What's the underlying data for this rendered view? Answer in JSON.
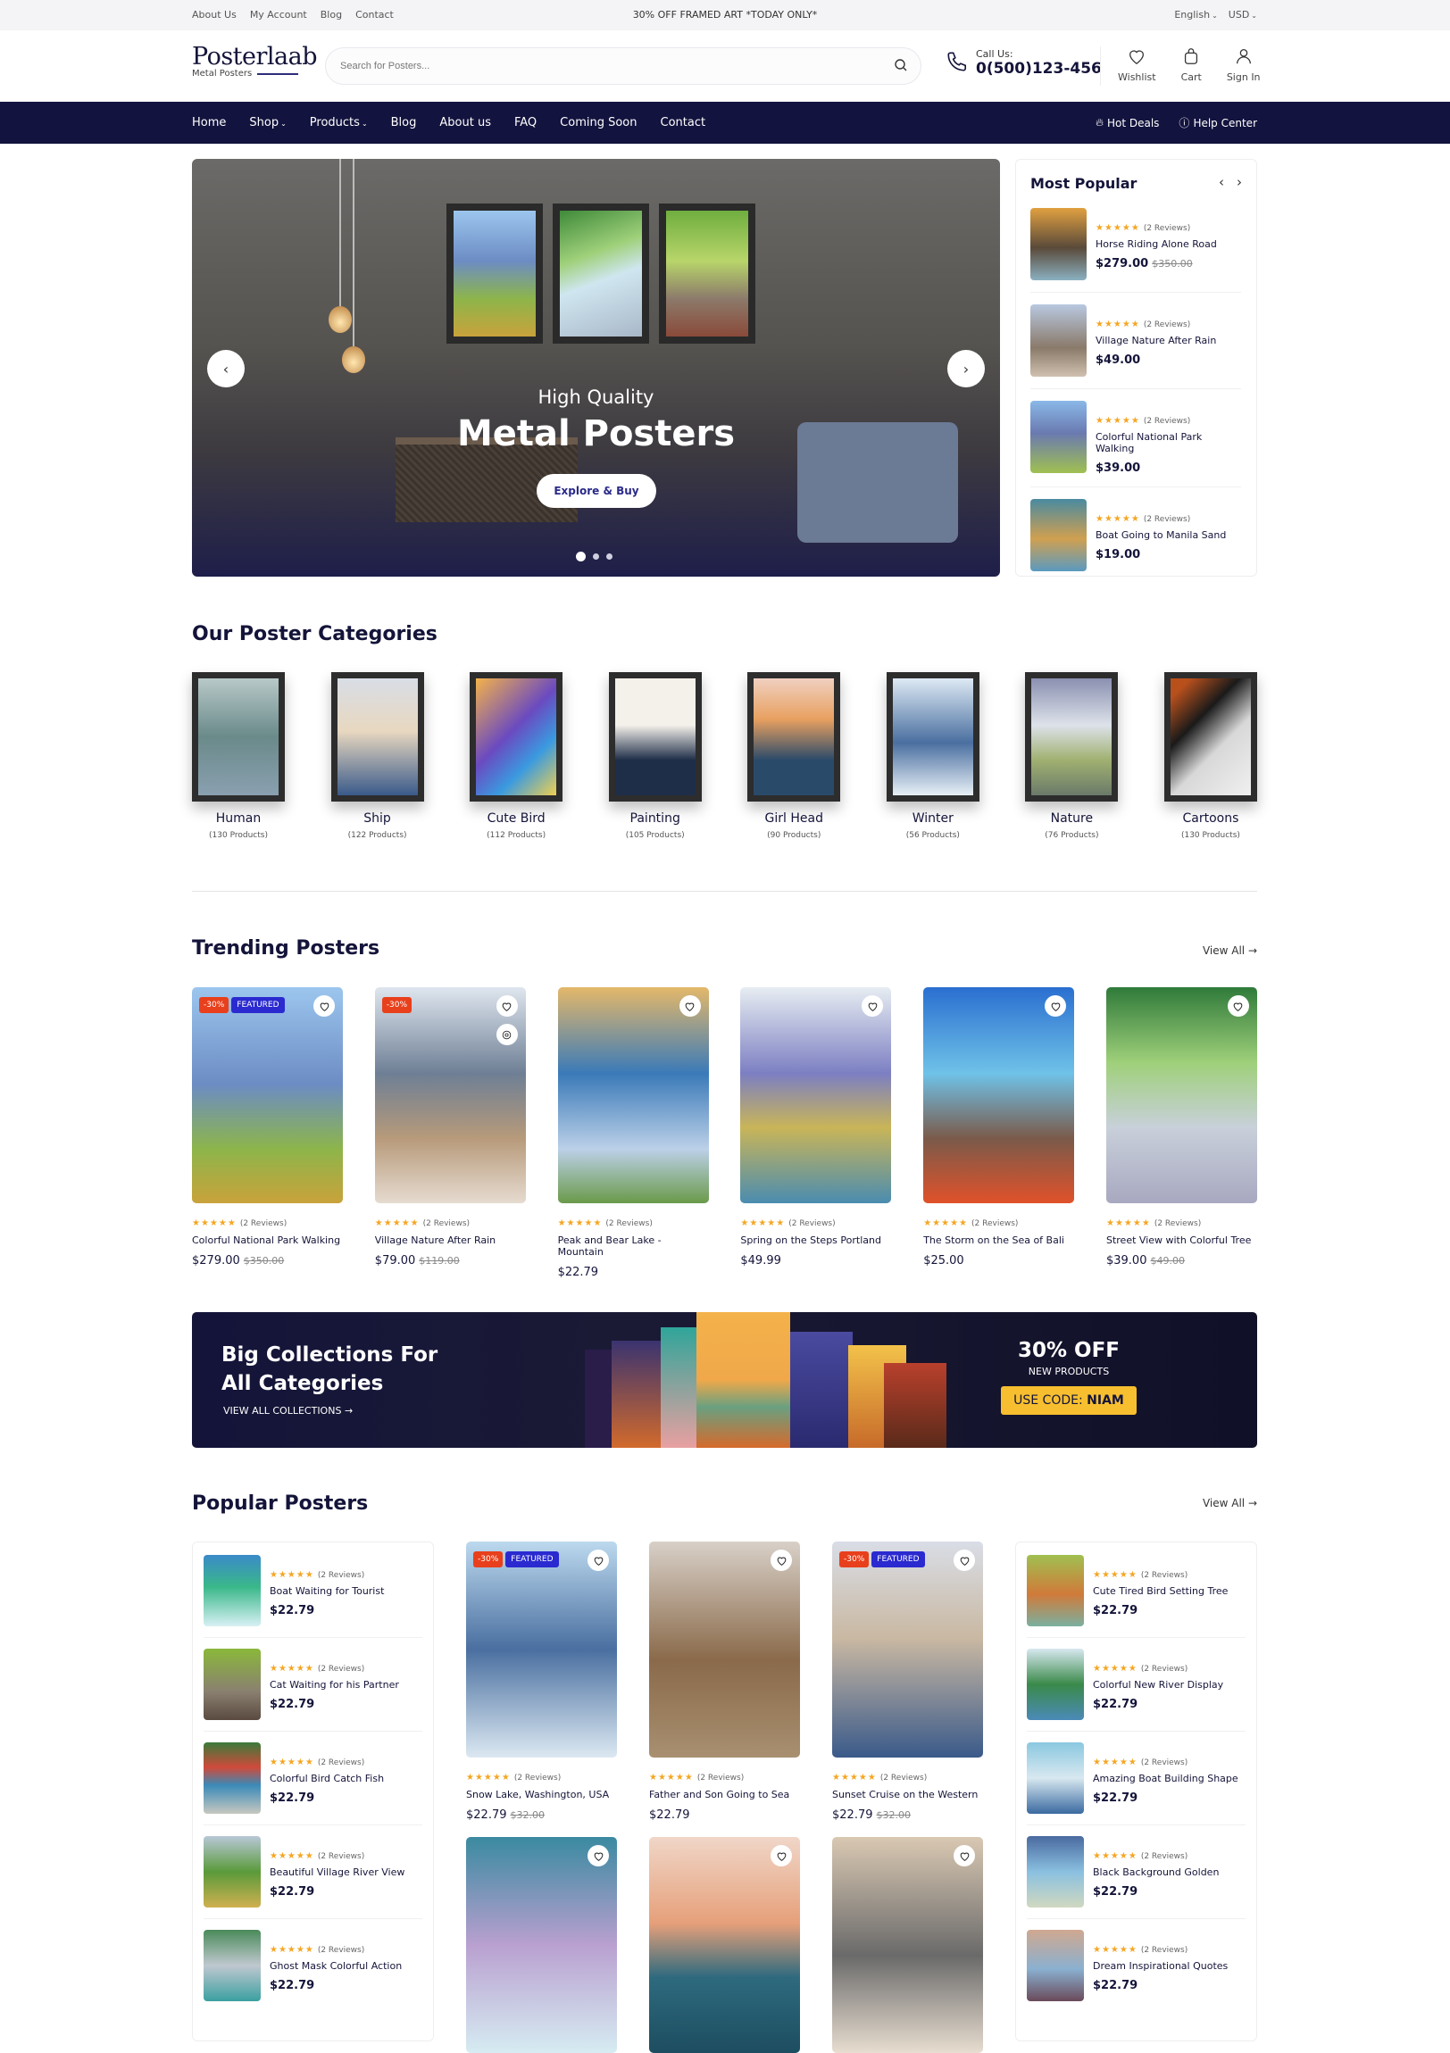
{
  "topbar": {
    "links": [
      "About Us",
      "My Account",
      "Blog",
      "Contact"
    ],
    "promo": "30% OFF FRAMED ART *TODAY ONLY*",
    "language": "English",
    "currency": "USD"
  },
  "header": {
    "logo_name": "Posterlaab",
    "logo_sub": "Metal Posters",
    "search_placeholder": "Search for Posters...",
    "call_label": "Call Us:",
    "phone": "0(500)123-456",
    "wishlist": "Wishlist",
    "cart": "Cart",
    "signin": "Sign In"
  },
  "nav": {
    "items": [
      {
        "label": "Home",
        "dropdown": false
      },
      {
        "label": "Shop",
        "dropdown": true
      },
      {
        "label": "Products",
        "dropdown": true
      },
      {
        "label": "Blog",
        "dropdown": false
      },
      {
        "label": "About us",
        "dropdown": false
      },
      {
        "label": "FAQ",
        "dropdown": false
      },
      {
        "label": "Coming Soon",
        "dropdown": false
      },
      {
        "label": "Contact",
        "dropdown": false
      }
    ],
    "hot_deals": "Hot Deals",
    "help_center": "Help Center"
  },
  "hero": {
    "subtitle": "High Quality",
    "title": "Metal Posters",
    "button": "Explore & Buy",
    "slide_count": 3,
    "active_slide": 1
  },
  "most_popular": {
    "title": "Most Popular",
    "items": [
      {
        "name": "Horse Riding Alone Road",
        "price": "$279.00",
        "old_price": "$350.00",
        "reviews": "(2 Reviews)",
        "rating": 5
      },
      {
        "name": "Village Nature After Rain",
        "price": "$49.00",
        "old_price": "",
        "reviews": "(2 Reviews)",
        "rating": 5
      },
      {
        "name": "Colorful National Park Walking",
        "price": "$39.00",
        "old_price": "",
        "reviews": "(2 Reviews)",
        "rating": 5
      },
      {
        "name": "Boat Going to Manila Sand",
        "price": "$19.00",
        "old_price": "",
        "reviews": "(2 Reviews)",
        "rating": 5
      }
    ]
  },
  "categories": {
    "title": "Our Poster Categories",
    "items": [
      {
        "name": "Human",
        "count": "(130 Products)"
      },
      {
        "name": "Ship",
        "count": "(122 Products)"
      },
      {
        "name": "Cute Bird",
        "count": "(112 Products)"
      },
      {
        "name": "Painting",
        "count": "(105 Products)"
      },
      {
        "name": "Girl Head",
        "count": "(90 Products)"
      },
      {
        "name": "Winter",
        "count": "(56 Products)"
      },
      {
        "name": "Nature",
        "count": "(76 Products)"
      },
      {
        "name": "Cartoons",
        "count": "(130 Products)"
      }
    ]
  },
  "trending": {
    "title": "Trending Posters",
    "view_all": "View All",
    "items": [
      {
        "name": "Colorful National Park Walking",
        "price": "$279.00",
        "old_price": "$350.00",
        "reviews": "(2 Reviews)",
        "discount": "-30%",
        "featured": "FEATURED",
        "quick_view": false
      },
      {
        "name": "Village Nature After Rain",
        "price": "$79.00",
        "old_price": "$119.00",
        "reviews": "(2 Reviews)",
        "discount": "-30%",
        "featured": "",
        "quick_view": true
      },
      {
        "name": "Peak and Bear Lake - Mountain",
        "price": "$22.79",
        "old_price": "",
        "reviews": "(2 Reviews)",
        "discount": "",
        "featured": "",
        "quick_view": false
      },
      {
        "name": "Spring on the Steps  Portland",
        "price": "$49.99",
        "old_price": "",
        "reviews": "(2 Reviews)",
        "discount": "",
        "featured": "",
        "quick_view": false
      },
      {
        "name": "The Storm on the Sea of Bali",
        "price": "$25.00",
        "old_price": "",
        "reviews": "(2 Reviews)",
        "discount": "",
        "featured": "",
        "quick_view": false
      },
      {
        "name": "Street View with Colorful Tree",
        "price": "$39.00",
        "old_price": "$49.00",
        "reviews": "(2 Reviews)",
        "discount": "",
        "featured": "",
        "quick_view": false
      }
    ]
  },
  "banner": {
    "title": "Big Collections For All Categories",
    "link": "VIEW ALL COLLECTIONS",
    "offer": "30% OFF",
    "offer_sub": "NEW PRODUCTS",
    "code_label": "USE CODE:",
    "code": "NIAM"
  },
  "popular": {
    "title": "Popular Posters",
    "view_all": "View All",
    "left_list": [
      {
        "name": "Boat Waiting for Tourist",
        "price": "$22.79",
        "reviews": "(2 Reviews)"
      },
      {
        "name": "Cat Waiting for his Partner",
        "price": "$22.79",
        "reviews": "(2 Reviews)"
      },
      {
        "name": "Colorful Bird Catch Fish",
        "price": "$22.79",
        "reviews": "(2 Reviews)"
      },
      {
        "name": "Beautiful Village River View",
        "price": "$22.79",
        "reviews": "(2 Reviews)"
      },
      {
        "name": "Ghost Mask Colorful Action",
        "price": "$22.79",
        "reviews": "(2 Reviews)"
      }
    ],
    "center_cards": [
      {
        "name": "Snow Lake, Washington, USA",
        "price": "$22.79",
        "old_price": "$32.00",
        "reviews": "(2 Reviews)",
        "discount": "-30%",
        "featured": "FEATURED"
      },
      {
        "name": "Father and Son Going to Sea",
        "price": "$22.79",
        "old_price": "",
        "reviews": "(2 Reviews)",
        "discount": "",
        "featured": ""
      },
      {
        "name": "Sunset Cruise on the Western",
        "price": "$22.79",
        "old_price": "$32.00",
        "reviews": "(2 Reviews)",
        "discount": "-30%",
        "featured": "FEATURED"
      },
      {
        "name": "",
        "price": "",
        "old_price": "",
        "reviews": "",
        "discount": "",
        "featured": ""
      },
      {
        "name": "",
        "price": "",
        "old_price": "",
        "reviews": "",
        "discount": "",
        "featured": ""
      },
      {
        "name": "",
        "price": "",
        "old_price": "",
        "reviews": "",
        "discount": "",
        "featured": ""
      }
    ],
    "right_list": [
      {
        "name": "Cute Tired Bird Setting Tree",
        "price": "$22.79",
        "reviews": "(2 Reviews)"
      },
      {
        "name": "Colorful New River Display",
        "price": "$22.79",
        "reviews": "(2 Reviews)"
      },
      {
        "name": "Amazing Boat Building Shape",
        "price": "$22.79",
        "reviews": "(2 Reviews)"
      },
      {
        "name": "Black Background Golden",
        "price": "$22.79",
        "reviews": "(2 Reviews)"
      },
      {
        "name": "Dream Inspirational Quotes",
        "price": "$22.79",
        "reviews": "(2 Reviews)"
      }
    ]
  },
  "colors": {
    "brand_navy": "#13133f",
    "star": "#f5a623",
    "discount_badge": "#e8401c",
    "featured_badge": "#2a2ad0",
    "coupon": "#f7bf2f"
  }
}
